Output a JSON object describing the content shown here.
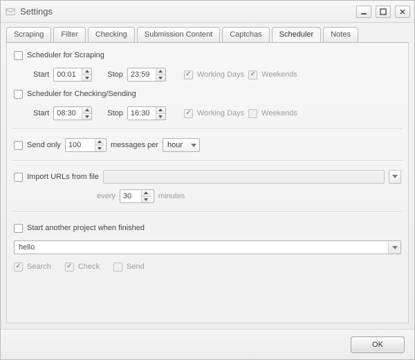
{
  "window": {
    "title": "Settings"
  },
  "tabs": {
    "items": [
      {
        "label": "Scraping"
      },
      {
        "label": "Filter"
      },
      {
        "label": "Checking"
      },
      {
        "label": "Submission Content"
      },
      {
        "label": "Captchas"
      },
      {
        "label": "Scheduler"
      },
      {
        "label": "Notes"
      }
    ]
  },
  "scheduler": {
    "scraping": {
      "label": "Scheduler for Scraping",
      "start_label": "Start",
      "start_value": "00:01",
      "stop_label": "Stop",
      "stop_value": "23:59",
      "working_days_label": "Working Days",
      "weekends_label": "Weekends"
    },
    "checking": {
      "label": "Scheduler for Checking/Sending",
      "start_label": "Start",
      "start_value": "08:30",
      "stop_label": "Stop",
      "stop_value": "16:30",
      "working_days_label": "Working Days",
      "weekends_label": "Weekends"
    },
    "send_only": {
      "label": "Send only",
      "count_value": "100",
      "middle_label": "messages per",
      "unit_value": "hour"
    },
    "import_urls": {
      "label": "Import URLs from file",
      "every_label": "every",
      "every_value": "30",
      "minutes_label": "minutes"
    },
    "start_project": {
      "label": "Start another project when finished",
      "value": "hello",
      "search_label": "Search",
      "check_label": "Check",
      "send_label": "Send"
    }
  },
  "footer": {
    "ok_label": "OK"
  }
}
